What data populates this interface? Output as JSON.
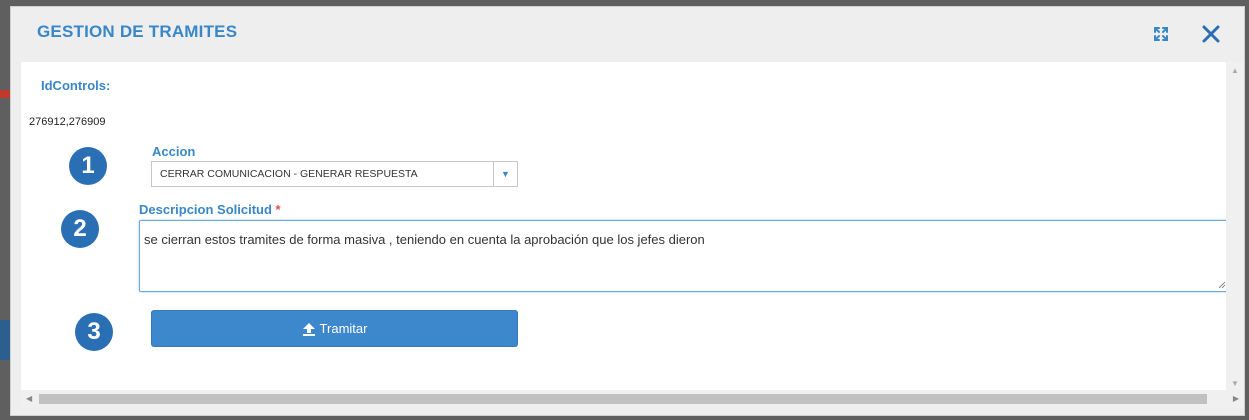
{
  "modal": {
    "title": "GESTION DE TRAMITES",
    "expand_icon": "expand-icon",
    "close_icon": "close-icon"
  },
  "idcontrols": {
    "label": "IdControls:",
    "value": "276912,276909"
  },
  "steps": [
    "1",
    "2",
    "3"
  ],
  "accion": {
    "label": "Accion",
    "selected": "CERRAR COMUNICACION - GENERAR RESPUESTA"
  },
  "descripcion": {
    "label": "Descripcion Solicitud",
    "required_mark": "*",
    "value": "se cierran estos tramites de forma masiva , teniendo en cuenta la aprobación que los jefes dieron"
  },
  "submit": {
    "label": "Tramitar",
    "icon": "upload-icon"
  },
  "colors": {
    "accent": "#3a87c8",
    "badge": "#2a6fb3",
    "button": "#3d87cc",
    "required": "#d9534f"
  }
}
